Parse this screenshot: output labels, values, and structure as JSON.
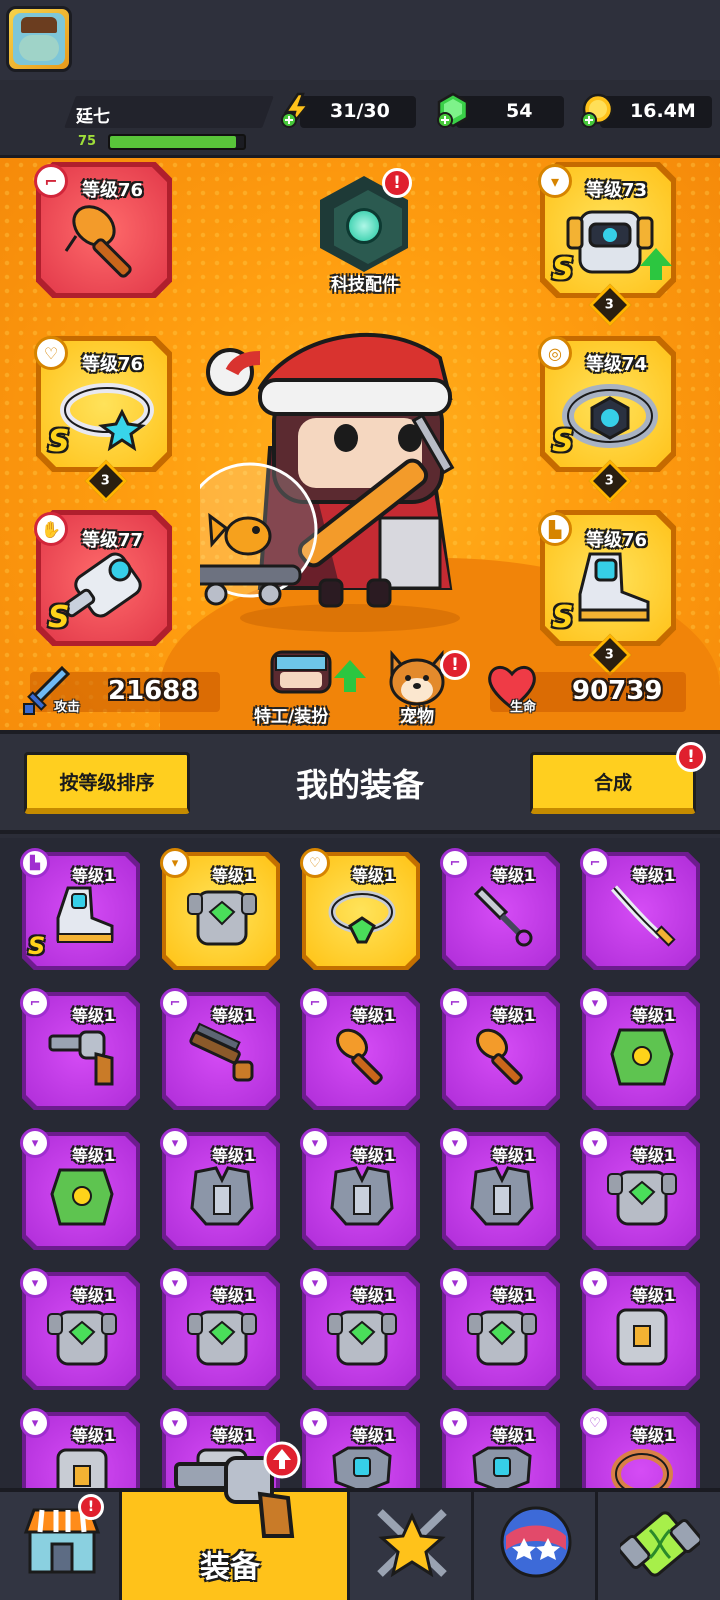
{
  "player": {
    "name": "廷七",
    "level": "75",
    "xp_fraction": 0.94
  },
  "resources": {
    "energy": "31/30",
    "gems": "54",
    "coins": "16.4M"
  },
  "tech": {
    "label": "科技配件"
  },
  "slots": [
    {
      "level": "等级76",
      "rank": "",
      "count": "",
      "color": "red",
      "badge": "weapon-icon"
    },
    {
      "level": "等级76",
      "rank": "S",
      "count": "3",
      "color": "gold",
      "badge": "necklace-icon"
    },
    {
      "level": "等级77",
      "rank": "S",
      "count": "",
      "color": "red",
      "badge": "glove-icon"
    },
    {
      "level": "等级73",
      "rank": "S",
      "count": "3",
      "color": "gold",
      "badge": "armor-icon"
    },
    {
      "level": "等级74",
      "rank": "S",
      "count": "3",
      "color": "gold",
      "badge": "belt-icon"
    },
    {
      "level": "等级76",
      "rank": "S",
      "count": "3",
      "color": "gold",
      "badge": "boots-icon"
    }
  ],
  "stats": {
    "attack_label": "攻击",
    "attack_value": "21688",
    "hp_label": "生命",
    "hp_value": "90739"
  },
  "hero_menu": {
    "agent_label": "特工/装扮",
    "pet_label": "宠物"
  },
  "equipment": {
    "sort_label": "按等级排序",
    "title": "我的装备",
    "merge_label": "合成"
  },
  "inventory": [
    {
      "level": "等级1",
      "color": "purple",
      "rank": "S",
      "type": "boots",
      "badge": "boots-icon"
    },
    {
      "level": "等级1",
      "color": "gold",
      "rank": "",
      "type": "armor-green",
      "badge": "armor-icon"
    },
    {
      "level": "等级1",
      "color": "gold",
      "rank": "",
      "type": "necklace",
      "badge": "necklace-icon"
    },
    {
      "level": "等级1",
      "color": "purple",
      "rank": "",
      "type": "kunai",
      "badge": "weapon-icon"
    },
    {
      "level": "等级1",
      "color": "purple",
      "rank": "",
      "type": "katana",
      "badge": "weapon-icon"
    },
    {
      "level": "等级1",
      "color": "purple",
      "rank": "",
      "type": "revolver",
      "badge": "weapon-icon"
    },
    {
      "level": "等级1",
      "color": "purple",
      "rank": "",
      "type": "shotgun",
      "badge": "weapon-icon"
    },
    {
      "level": "等级1",
      "color": "purple",
      "rank": "",
      "type": "bat",
      "badge": "weapon-icon"
    },
    {
      "level": "等级1",
      "color": "purple",
      "rank": "",
      "type": "bat",
      "badge": "weapon-icon"
    },
    {
      "level": "等级1",
      "color": "purple",
      "rank": "",
      "type": "vest-green",
      "badge": "armor-icon"
    },
    {
      "level": "等级1",
      "color": "purple",
      "rank": "",
      "type": "vest-green",
      "badge": "armor-icon"
    },
    {
      "level": "等级1",
      "color": "purple",
      "rank": "",
      "type": "armor-silver",
      "badge": "armor-icon"
    },
    {
      "level": "等级1",
      "color": "purple",
      "rank": "",
      "type": "armor-silver",
      "badge": "armor-icon"
    },
    {
      "level": "等级1",
      "color": "purple",
      "rank": "",
      "type": "armor-silver",
      "badge": "armor-icon"
    },
    {
      "level": "等级1",
      "color": "purple",
      "rank": "",
      "type": "armor-green",
      "badge": "armor-icon"
    },
    {
      "level": "等级1",
      "color": "purple",
      "rank": "",
      "type": "armor-green",
      "badge": "armor-icon"
    },
    {
      "level": "等级1",
      "color": "purple",
      "rank": "",
      "type": "armor-green",
      "badge": "armor-icon"
    },
    {
      "level": "等级1",
      "color": "purple",
      "rank": "",
      "type": "armor-green",
      "badge": "armor-icon"
    },
    {
      "level": "等级1",
      "color": "purple",
      "rank": "",
      "type": "armor-green",
      "badge": "armor-icon"
    },
    {
      "level": "等级1",
      "color": "purple",
      "rank": "",
      "type": "armor-box",
      "badge": "armor-icon"
    },
    {
      "level": "等级1",
      "color": "purple",
      "rank": "",
      "type": "armor-box",
      "badge": "armor-icon"
    },
    {
      "level": "等级1",
      "color": "purple",
      "rank": "",
      "type": "armor-box",
      "badge": "armor-icon"
    },
    {
      "level": "等级1",
      "color": "purple",
      "rank": "",
      "type": "armor-plate",
      "badge": "armor-icon"
    },
    {
      "level": "等级1",
      "color": "purple",
      "rank": "",
      "type": "armor-plate",
      "badge": "armor-icon"
    },
    {
      "level": "等级1",
      "color": "purple",
      "rank": "",
      "type": "ring",
      "badge": "necklace-icon"
    }
  ],
  "nav": {
    "equip_label": "装备"
  },
  "colors": {
    "hero_bg": "#ff9e10",
    "slot_gold": "#ffc21a",
    "slot_red": "#e2394a",
    "item_purple": "#b02ed9",
    "alert_red": "#e0202e"
  }
}
